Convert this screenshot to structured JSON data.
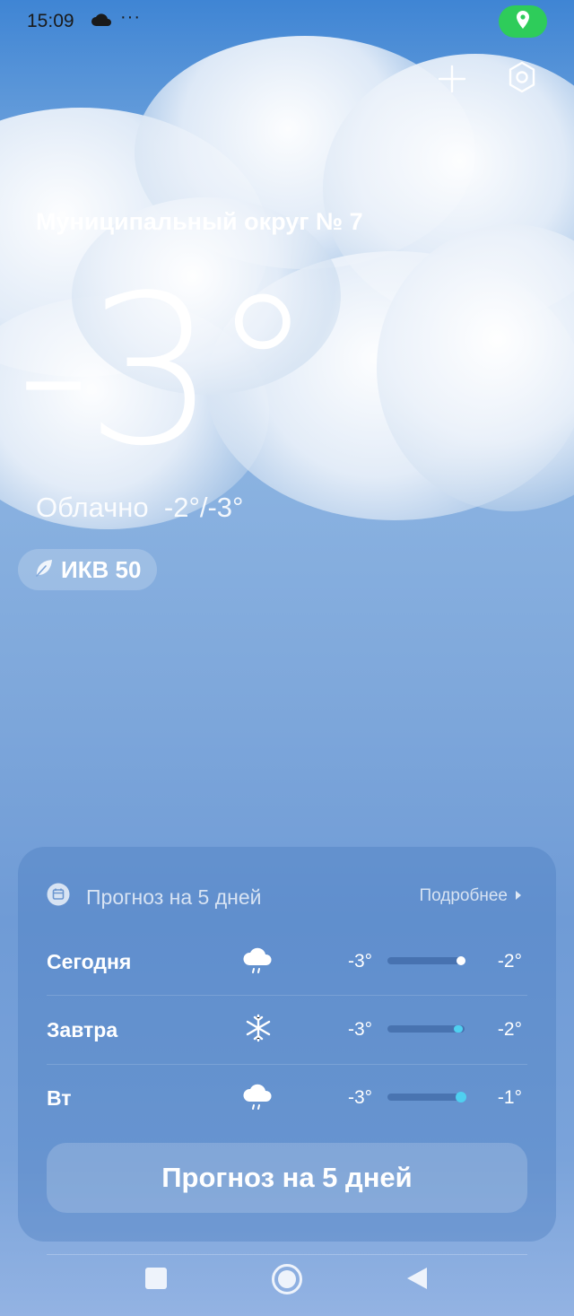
{
  "status_bar": {
    "time": "15:09",
    "dots": "···",
    "weather_icon": "cloud-icon",
    "location_icon": "location-pin-icon"
  },
  "top_actions": {
    "add_icon": "plus-icon",
    "settings_icon": "settings-icon"
  },
  "current": {
    "location": "Муниципальный округ № 7",
    "temperature": "-3°",
    "condition": "Облачно",
    "range": "-2°/-3°",
    "aqi_label": "ИКВ 50"
  },
  "forecast": {
    "title": "Прогноз на 5 дней",
    "more_label": "Подробнее",
    "button_label": "Прогноз на 5 дней",
    "days": [
      {
        "day": "Сегодня",
        "icon": "snow-cloud-icon",
        "low": "-3°",
        "high": "-2°",
        "dot_color": "#ffffff"
      },
      {
        "day": "Завтра",
        "icon": "snowflake-icon",
        "low": "-3°",
        "high": "-2°",
        "dot_color": "#4fd0f0"
      },
      {
        "day": "Вт",
        "icon": "snow-cloud-icon",
        "low": "-3°",
        "high": "-1°",
        "dot_color": "#4fd0f0"
      }
    ]
  },
  "colors": {
    "accent_green": "#2ecc5a",
    "bar_cyan": "#4fd0f0"
  }
}
